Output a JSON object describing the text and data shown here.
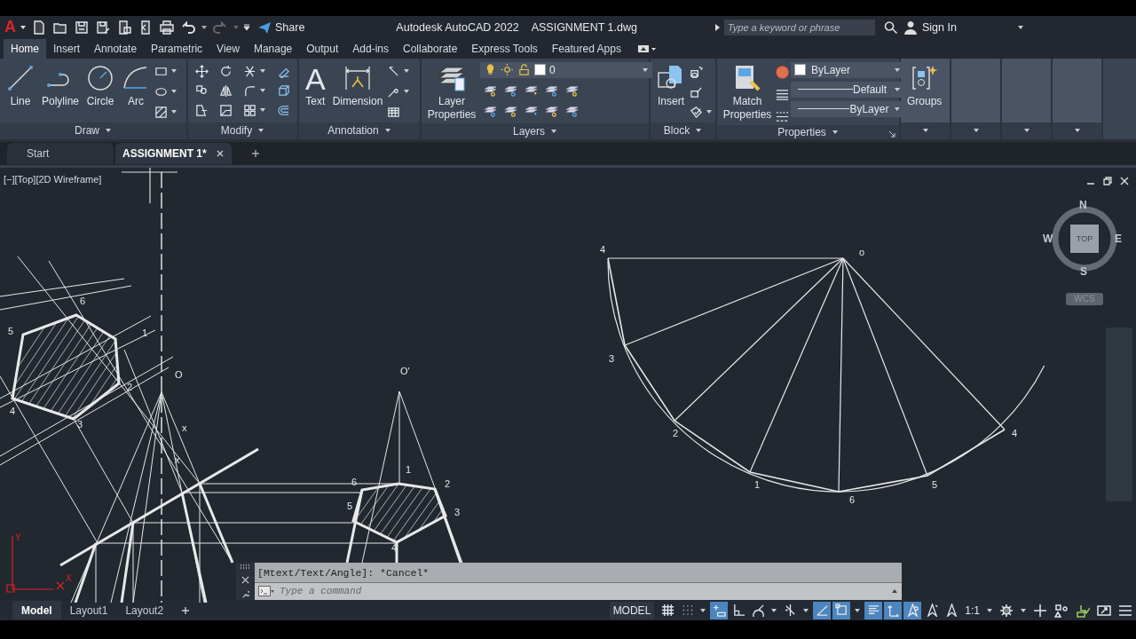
{
  "app_logo": "A",
  "quick_access": {
    "share": "Share"
  },
  "title": {
    "app": "Autodesk AutoCAD 2022",
    "file": "ASSIGNMENT 1.dwg"
  },
  "search": {
    "placeholder": "Type a keyword or phrase"
  },
  "sign_in": "Sign In",
  "ribbon_tabs": [
    {
      "label": "Home",
      "selected": true
    },
    {
      "label": "Insert",
      "selected": false
    },
    {
      "label": "Annotate",
      "selected": false
    },
    {
      "label": "Parametric",
      "selected": false
    },
    {
      "label": "View",
      "selected": false
    },
    {
      "label": "Manage",
      "selected": false
    },
    {
      "label": "Output",
      "selected": false
    },
    {
      "label": "Add-ins",
      "selected": false
    },
    {
      "label": "Collaborate",
      "selected": false
    },
    {
      "label": "Express Tools",
      "selected": false
    },
    {
      "label": "Featured Apps",
      "selected": false
    }
  ],
  "panels": [
    {
      "kind": "draw",
      "title": "Draw",
      "tools": [
        "Line",
        "Polyline",
        "Circle",
        "Arc"
      ]
    },
    {
      "kind": "modify",
      "title": "Modify"
    },
    {
      "kind": "annotation",
      "title": "Annotation",
      "text_glyph": "A",
      "tools": [
        "Text",
        "Dimension"
      ]
    },
    {
      "kind": "layers",
      "title": "Layers",
      "tools": [
        "Layer Properties"
      ],
      "layer": "0"
    },
    {
      "kind": "block",
      "title": "Block",
      "tools": [
        "Insert"
      ]
    },
    {
      "kind": "properties",
      "title": "Properties",
      "tools": [
        "Match Properties"
      ],
      "combos": [
        "ByLayer",
        "Default",
        "ByLayer"
      ]
    },
    {
      "kind": "groups",
      "tools": [
        "Groups"
      ]
    }
  ],
  "doc_tabs": [
    {
      "label": "Start",
      "selected": false
    },
    {
      "label": "ASSIGNMENT 1*",
      "selected": true
    }
  ],
  "viewport_label": "[−][Top][2D Wireframe]",
  "viewcube": {
    "north": "N",
    "south": "S",
    "east": "E",
    "west": "W",
    "face": "TOP",
    "ucs": "WCS"
  },
  "ucs_icon": {
    "x": "X",
    "y": "Y"
  },
  "left_view_labels": [
    "6",
    "5",
    "1",
    "2",
    "4",
    "3",
    "O",
    "x",
    "x"
  ],
  "front_view_labels": [
    "O'",
    "1",
    "6",
    "2",
    "5",
    "3",
    "4"
  ],
  "development_labels": [
    "4",
    "o",
    "3",
    "2",
    "1",
    "6",
    "5",
    "4"
  ],
  "command": {
    "history": "[Mtext/Text/Angle]: *Cancel*",
    "placeholder": "Type a command"
  },
  "layout_tabs": [
    {
      "label": "Model",
      "selected": true
    },
    {
      "label": "Layout1",
      "selected": false
    },
    {
      "label": "Layout2",
      "selected": false
    }
  ],
  "status": {
    "model": "MODEL",
    "scale": "1:1"
  },
  "status_toggles": [
    {
      "on": false
    },
    {
      "on": false
    },
    {
      "on": true
    },
    {
      "on": false
    },
    {
      "on": false
    },
    {
      "on": false
    },
    {
      "on": true
    },
    {
      "on": true
    },
    {
      "on": true
    },
    {
      "on": true
    },
    {
      "on": true
    },
    {
      "on": false
    },
    {
      "on": false
    }
  ]
}
